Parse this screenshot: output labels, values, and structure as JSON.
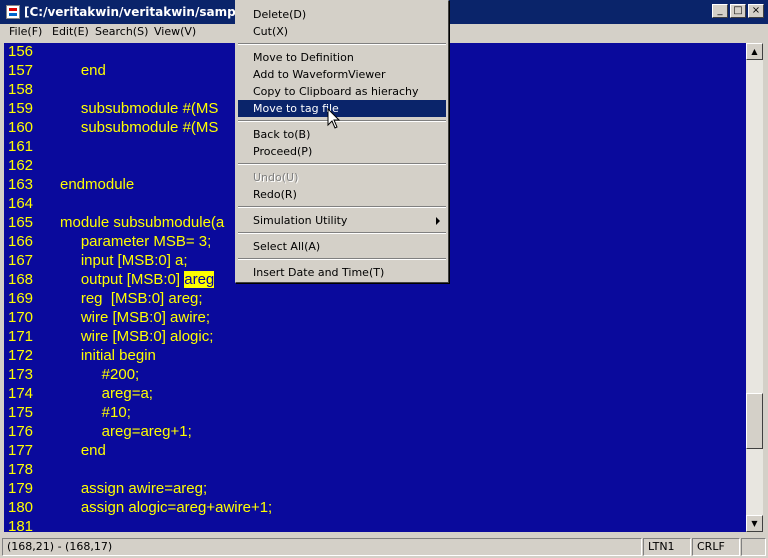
{
  "window": {
    "title": "[C:/veritakwin/veritakwin/samples/r",
    "buttons": {
      "minimize": "_",
      "maximize": "□",
      "close": "×"
    }
  },
  "menubar": [
    {
      "label": "File(F)"
    },
    {
      "label": "Edit(E)"
    },
    {
      "label": "Search(S)"
    },
    {
      "label": "View(V)"
    }
  ],
  "editor": {
    "lines": [
      {
        "num": "156",
        "code": ""
      },
      {
        "num": "157",
        "code": "     end"
      },
      {
        "num": "158",
        "code": ""
      },
      {
        "num": "159",
        "code": "     subsubmodule #(MS"
      },
      {
        "num": "160",
        "code": "     subsubmodule #(MS"
      },
      {
        "num": "161",
        "code": ""
      },
      {
        "num": "162",
        "code": ""
      },
      {
        "num": "163",
        "code": "endmodule"
      },
      {
        "num": "164",
        "code": ""
      },
      {
        "num": "165",
        "code": "module subsubmodule(a"
      },
      {
        "num": "166",
        "code": "     parameter MSB= 3;"
      },
      {
        "num": "167",
        "code": "     input [MSB:0] a;"
      },
      {
        "num": "168",
        "code": "     output [MSB:0] ",
        "highlight": "areg"
      },
      {
        "num": "169",
        "code": "     reg  [MSB:0] areg;"
      },
      {
        "num": "170",
        "code": "     wire [MSB:0] awire;"
      },
      {
        "num": "171",
        "code": "     wire [MSB:0] alogic;"
      },
      {
        "num": "172",
        "code": "     initial begin"
      },
      {
        "num": "173",
        "code": "          #200;"
      },
      {
        "num": "174",
        "code": "          areg=a;"
      },
      {
        "num": "175",
        "code": "          #10;"
      },
      {
        "num": "176",
        "code": "          areg=areg+1;"
      },
      {
        "num": "177",
        "code": "     end"
      },
      {
        "num": "178",
        "code": ""
      },
      {
        "num": "179",
        "code": "     assign awire=areg;"
      },
      {
        "num": "180",
        "code": "     assign alogic=areg+awire+1;"
      },
      {
        "num": "181",
        "code": ""
      }
    ]
  },
  "context_menu": {
    "items": [
      {
        "label": "Delete(D)",
        "state": "normal"
      },
      {
        "label": "Cut(X)",
        "state": "normal"
      },
      {
        "sep": true
      },
      {
        "label": "Move to Definition",
        "state": "normal"
      },
      {
        "label": "Add to WaveformViewer",
        "state": "normal"
      },
      {
        "label": "Copy to Clipboard as hierachy name",
        "state": "normal"
      },
      {
        "label": "Move to tag file",
        "state": "selected"
      },
      {
        "sep": true
      },
      {
        "label": "Back to(B)",
        "state": "normal"
      },
      {
        "label": "Proceed(P)",
        "state": "normal"
      },
      {
        "sep": true
      },
      {
        "label": "Undo(U)",
        "state": "disabled"
      },
      {
        "label": "Redo(R)",
        "state": "normal"
      },
      {
        "sep": true
      },
      {
        "label": "Simulation Utility",
        "state": "normal",
        "submenu": true
      },
      {
        "sep": true
      },
      {
        "label": "Select All(A)",
        "state": "normal"
      },
      {
        "sep": true
      },
      {
        "label": "Insert Date and Time(T)",
        "state": "normal"
      }
    ]
  },
  "statusbar": {
    "position": "(168,21) - (168,17)",
    "encoding": "LTN1",
    "line_ending": "CRLF"
  },
  "colors": {
    "editor_bg": "#0a0a9c",
    "keyword": "#ffff00",
    "selection": "#0a246a"
  }
}
